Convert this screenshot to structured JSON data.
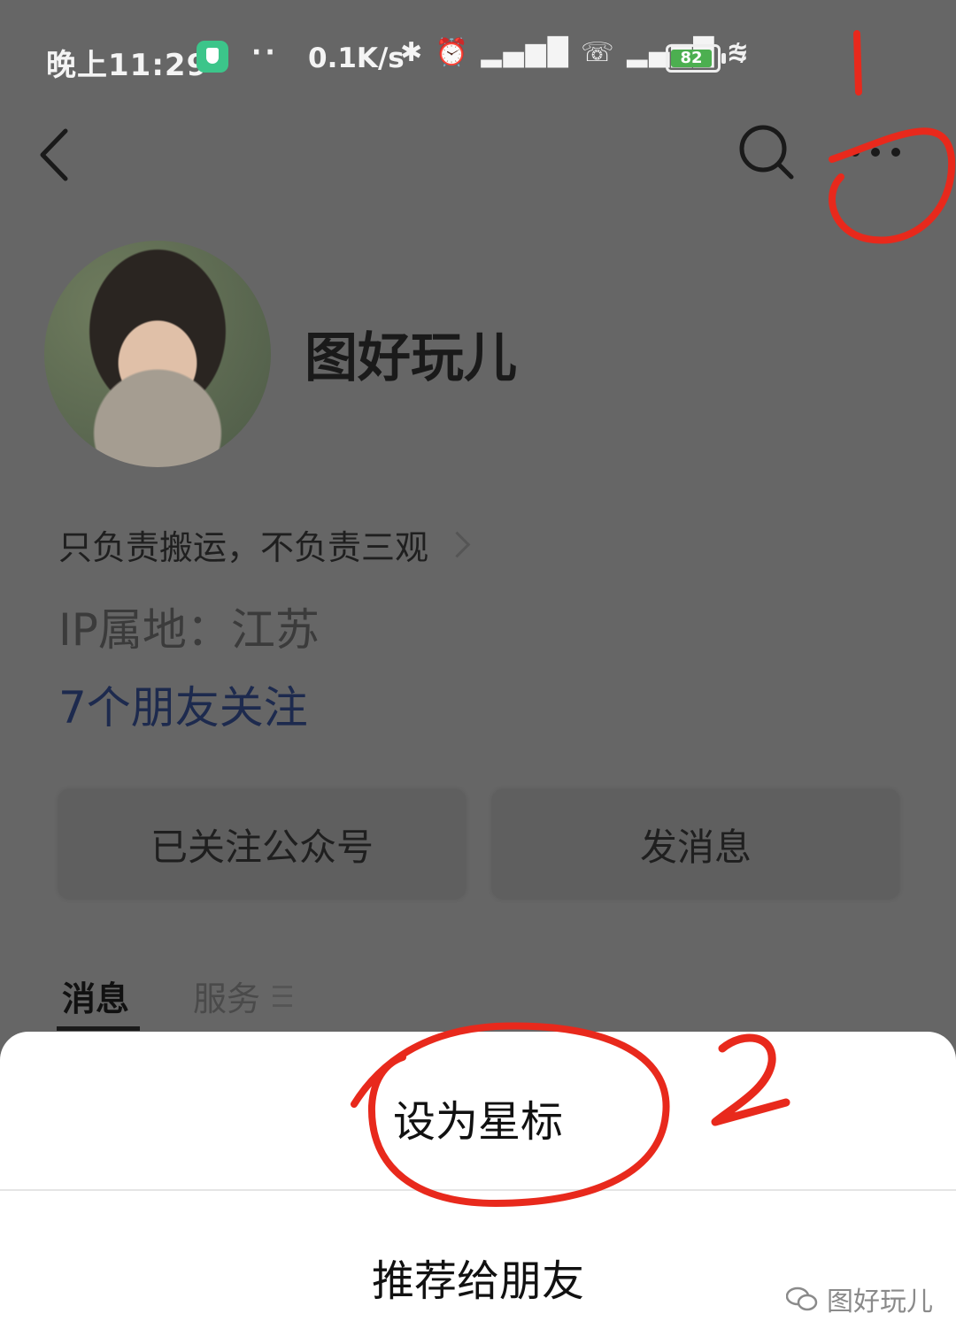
{
  "status_bar": {
    "time": "晚上11:29",
    "dots": "··",
    "net_speed": "0.1K/s",
    "icons_text": "✱ ⏰ ▂▄▆█ ☏ ▂▄▆█ ≋",
    "battery_level": "82",
    "charging_icon": "bolt-icon"
  },
  "nav": {
    "back_icon": "chevron-left-icon",
    "search_icon": "search-icon",
    "more_icon": "more-dots-icon"
  },
  "profile": {
    "name": "图好玩儿",
    "bio": "只负责搬运，不负责三观",
    "ip_location": "IP属地：江苏",
    "friends_following": "7个朋友关注"
  },
  "actions": {
    "followed_label": "已关注公众号",
    "message_label": "发消息"
  },
  "tabs": [
    {
      "label": "消息",
      "active": true
    },
    {
      "label": "服务",
      "active": false
    }
  ],
  "sheet": {
    "star_label": "设为星标",
    "recommend_label": "推荐给朋友"
  },
  "watermark": {
    "text": "图好玩儿",
    "icon": "wechat-icon"
  },
  "annotations": {
    "mark_1": "1",
    "mark_2": "2",
    "color": "#e8291c"
  },
  "colors": {
    "overlay_bg": "#666666",
    "sheet_bg": "#ffffff",
    "friends_link": "#1d2a4e"
  }
}
